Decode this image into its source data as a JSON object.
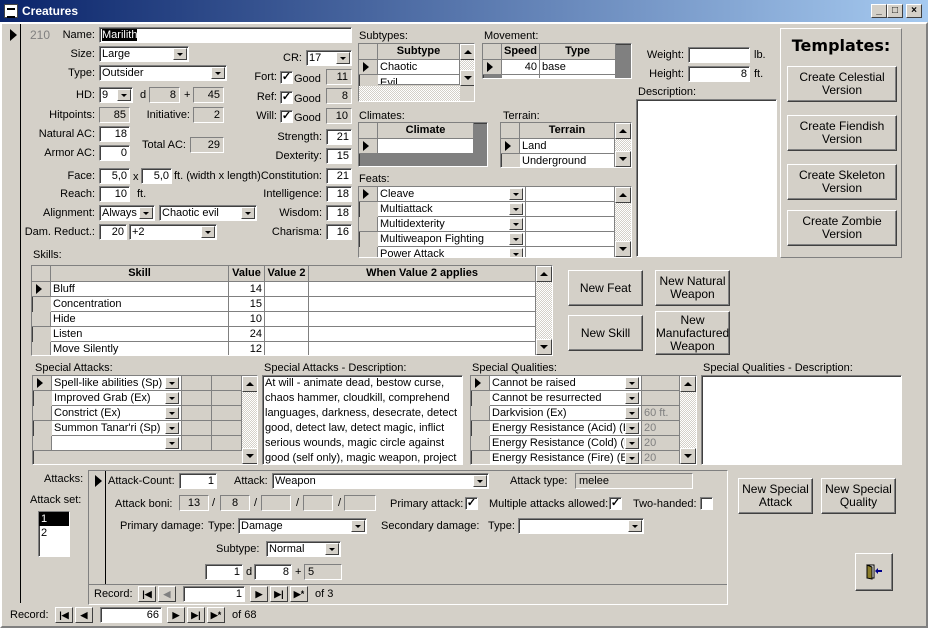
{
  "window": {
    "title": "Creatures",
    "minimize": "_",
    "maximize": "□",
    "close": "×"
  },
  "record_id": "210",
  "main": {
    "name_label": "Name:",
    "name": "Marilith",
    "size_label": "Size:",
    "size": "Large",
    "type_label": "Type:",
    "type": "Outsider",
    "hd_label": "HD:",
    "hd_count": "9",
    "hd_d": "d",
    "hd_die": "8",
    "hd_plus": "+",
    "hd_bonus": "45",
    "hitpoints_label": "Hitpoints:",
    "hitpoints": "85",
    "initiative_label": "Initiative:",
    "initiative": "2",
    "natural_ac_label": "Natural AC:",
    "natural_ac": "18",
    "armor_ac_label": "Armor AC:",
    "armor_ac": "0",
    "total_ac_label": "Total AC:",
    "total_ac": "29",
    "face_label": "Face:",
    "face_w": "5,0",
    "face_x": "x",
    "face_l": "5,0",
    "face_unit": "ft. (width x length)",
    "reach_label": "Reach:",
    "reach": "10",
    "reach_unit": "ft.",
    "alignment_label": "Alignment:",
    "alignment_freq": "Always",
    "alignment": "Chaotic evil",
    "dr_label": "Dam. Reduct.:",
    "dr_value": "20",
    "dr_type": "+2",
    "cr_label": "CR:",
    "cr": "17",
    "saves": [
      {
        "label": "Fort:",
        "good": "Good",
        "checked": true,
        "value": "11"
      },
      {
        "label": "Ref:",
        "good": "Good",
        "checked": true,
        "value": "8"
      },
      {
        "label": "Will:",
        "good": "Good",
        "checked": true,
        "value": "10"
      }
    ],
    "abilities": [
      {
        "label": "Strength:",
        "value": "21"
      },
      {
        "label": "Dexterity:",
        "value": "15"
      },
      {
        "label": "Constitution:",
        "value": "21"
      },
      {
        "label": "Intelligence:",
        "value": "18"
      },
      {
        "label": "Wisdom:",
        "value": "18"
      },
      {
        "label": "Charisma:",
        "value": "16"
      }
    ]
  },
  "subtypes": {
    "label": "Subtypes:",
    "header": "Subtype",
    "rows": [
      "Chaotic",
      "Evil"
    ]
  },
  "movement": {
    "label": "Movement:",
    "headers": [
      "Speed",
      "Type"
    ],
    "rows": [
      {
        "speed": "40",
        "type": "base"
      }
    ],
    "new_row": "✱"
  },
  "climates": {
    "label": "Climates:",
    "header": "Climate",
    "rows": [
      ""
    ]
  },
  "terrain": {
    "label": "Terrain:",
    "header": "Terrain",
    "rows": [
      "Land",
      "Underground"
    ]
  },
  "feats": {
    "label": "Feats:",
    "rows": [
      "Cleave",
      "Multiattack",
      "Multidexterity",
      "Multiweapon Fighting",
      "Power Attack"
    ]
  },
  "physical": {
    "weight_label": "Weight:",
    "weight": "",
    "weight_unit": "lb.",
    "height_label": "Height:",
    "height": "8",
    "height_unit": "ft.",
    "description_label": "Description:",
    "description": ""
  },
  "templates": {
    "title": "Templates:",
    "buttons": [
      "Create Celestial Version",
      "Create Fiendish Version",
      "Create Skeleton Version",
      "Create Zombie Version"
    ]
  },
  "skills": {
    "label": "Skills:",
    "headers": [
      "Skill",
      "Value",
      "Value 2",
      "When Value 2 applies"
    ],
    "rows": [
      {
        "skill": "Bluff",
        "value": "14",
        "value2": "",
        "when": ""
      },
      {
        "skill": "Concentration",
        "value": "15",
        "value2": "",
        "when": ""
      },
      {
        "skill": "Hide",
        "value": "10",
        "value2": "",
        "when": ""
      },
      {
        "skill": "Listen",
        "value": "24",
        "value2": "",
        "when": ""
      },
      {
        "skill": "Move Silently",
        "value": "12",
        "value2": "",
        "when": ""
      }
    ]
  },
  "action_buttons": {
    "new_feat": "New Feat",
    "new_natural_weapon": "New Natural Weapon",
    "new_skill": "New Skill",
    "new_manufactured_weapon": "New Manufactured Weapon",
    "new_special_attack": "New Special Attack",
    "new_special_quality": "New Special Quality"
  },
  "special_attacks": {
    "label": "Special Attacks:",
    "rows": [
      "Spell-like abilities (Sp)",
      "Improved Grab (Ex)",
      "Constrict (Ex)",
      "Summon Tanar'ri (Sp)",
      ""
    ],
    "new_row": "✱"
  },
  "special_attacks_desc": {
    "label": "Special Attacks - Description:",
    "text": "At will - animate dead, bestow curse, chaos hammer, cloudkill, comprehend languages, darkness, desecrate, detect good, detect law, detect magic, inflict serious wounds, magic circle against good (self only), magic weapon, project image,"
  },
  "special_qualities": {
    "label": "Special Qualities:",
    "rows": [
      {
        "name": "Cannot be raised",
        "value": ""
      },
      {
        "name": "Cannot be resurrected",
        "value": ""
      },
      {
        "name": "Darkvision (Ex)",
        "value": "60 ft."
      },
      {
        "name": "Energy Resistance (Acid) (E",
        "value": "20"
      },
      {
        "name": "Energy Resistance (Cold) (E",
        "value": "20"
      },
      {
        "name": "Energy Resistance (Fire) (Ex",
        "value": "20"
      }
    ]
  },
  "special_qualities_desc": {
    "label": "Special Qualities - Description:",
    "text": ""
  },
  "attacks": {
    "label": "Attacks:",
    "set_label": "Attack set:",
    "sets": [
      "1",
      "2"
    ],
    "selected_set": "1",
    "count_label": "Attack-Count:",
    "count": "1",
    "attack_label": "Attack:",
    "attack": "Weapon",
    "type_label": "Attack type:",
    "type": "melee",
    "boni_label": "Attack boni:",
    "boni": [
      "13",
      "8",
      "",
      "",
      ""
    ],
    "sep": "/",
    "primary_label": "Primary attack:",
    "primary": true,
    "multiple_label": "Multiple attacks allowed:",
    "multiple": true,
    "two_handed_label": "Two-handed:",
    "two_handed": false,
    "primary_damage_label": "Primary damage:",
    "dmg_type_label": "Type:",
    "dmg_type": "Damage",
    "secondary_damage_label": "Secondary damage:",
    "sec_type_label": "Type:",
    "sec_type": "",
    "subtype_label": "Subtype:",
    "subtype": "Normal",
    "dice_count": "1",
    "dice_d": "d",
    "dice_die": "8",
    "dice_plus": "+",
    "dice_bonus": "5"
  },
  "sub_nav": {
    "label": "Record:",
    "current": "1",
    "of": "of",
    "total": "3"
  },
  "main_nav": {
    "label": "Record:",
    "current": "66",
    "of": "of",
    "total": "68"
  }
}
